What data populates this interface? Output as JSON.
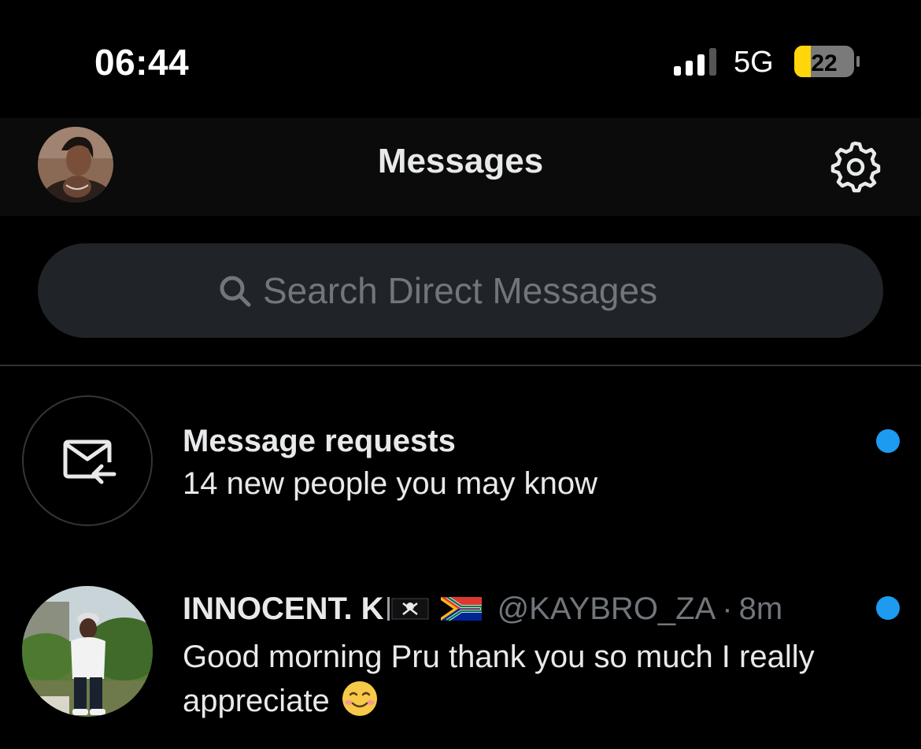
{
  "status_bar": {
    "time": "06:44",
    "network": "5G",
    "battery": "22",
    "battery_color": "#ffd60a"
  },
  "header": {
    "title": "Messages",
    "avatar_icon": "profile-avatar",
    "settings_icon": "gear-icon"
  },
  "search": {
    "placeholder": "Search Direct Messages",
    "icon": "search-icon"
  },
  "message_requests": {
    "title": "Message requests",
    "subtitle": "14 new people you may know",
    "icon": "envelope-arrow-icon",
    "unread": true
  },
  "conversations": [
    {
      "name": "INNOCENT. K",
      "name_flags": [
        "pirate-flag",
        "south-africa-flag"
      ],
      "handle": "@KAYBRO_ZA",
      "separator": "·",
      "time": "8m",
      "message": "Good morning Pru thank you so much I really appreciate",
      "emoji": "smiling-face-icon",
      "unread": true
    }
  ],
  "colors": {
    "background": "#000000",
    "header_bg": "#0b0b0b",
    "search_bg": "#202327",
    "accent_blue": "#1d9bf0",
    "secondary_text": "#71767b",
    "primary_text": "#e7e9ea"
  }
}
